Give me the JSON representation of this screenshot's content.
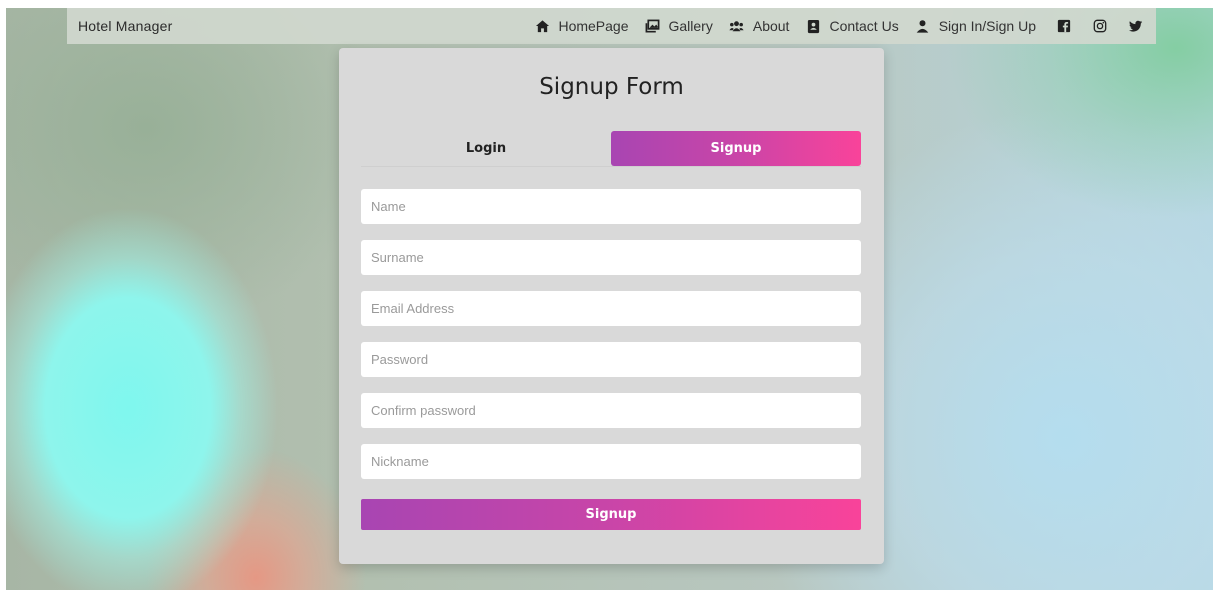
{
  "navbar": {
    "brand": "Hotel Manager",
    "links": [
      {
        "label": "HomePage",
        "icon": "home-icon"
      },
      {
        "label": "Gallery",
        "icon": "gallery-icon"
      },
      {
        "label": "About",
        "icon": "users-icon"
      },
      {
        "label": "Contact Us",
        "icon": "contact-card-icon"
      },
      {
        "label": "Sign In/Sign Up",
        "icon": "user-icon"
      }
    ],
    "social": [
      "facebook-icon",
      "instagram-icon",
      "twitter-icon"
    ]
  },
  "form": {
    "title": "Signup Form",
    "tabs": [
      {
        "label": "Login",
        "active": false
      },
      {
        "label": "Signup",
        "active": true
      }
    ],
    "fields": [
      {
        "placeholder": "Name",
        "value": ""
      },
      {
        "placeholder": "Surname",
        "value": ""
      },
      {
        "placeholder": "Email Address",
        "value": ""
      },
      {
        "placeholder": "Password",
        "value": ""
      },
      {
        "placeholder": "Confirm password",
        "value": ""
      },
      {
        "placeholder": "Nickname",
        "value": ""
      }
    ],
    "submit_label": "Signup"
  },
  "colors": {
    "accent_start": "#a845b2",
    "accent_end": "#f9439a",
    "card_bg": "#d9d9d9"
  }
}
